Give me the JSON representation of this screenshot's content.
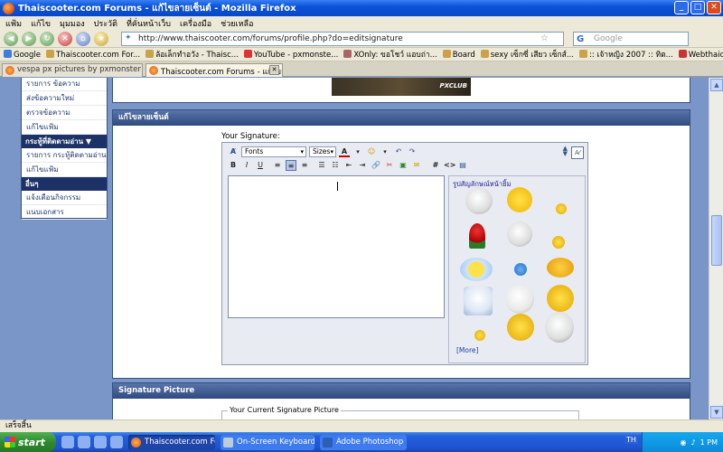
{
  "window": {
    "title": "Thaiscooter.com Forums - แก้ไขลายเซ็นต์ - Mozilla Firefox"
  },
  "menu": [
    "แฟ้ม",
    "แก้ไข",
    "มุมมอง",
    "ประวัติ",
    "ที่คั่นหน้าเว็บ",
    "เครื่องมือ",
    "ช่วยเหลือ"
  ],
  "address": {
    "url": "http://www.thaiscooter.com/forums/profile.php?do=editsignature"
  },
  "search": {
    "placeholder": "Google",
    "engine": "G"
  },
  "bookmarks": [
    "Google",
    "Thaiscooter.com For...",
    "ล้อเล็กทำอวัง - Thaisc...",
    "YouTube - pxmonste...",
    "XOnly: ขอโชว์ แอบถ่า...",
    "Board",
    "sexy เซ็กซี่ เสียว เซ็กส์...",
    ":: เจ้าหญิง 2007 :: ทิต...",
    "Webthaidd.COM รีลอ..."
  ],
  "tabs": [
    {
      "label": "vespa px pictures by pxmonster - ...",
      "active": false
    },
    {
      "label": "Thaiscooter.com Forums - แก้ไขลา...",
      "active": true
    }
  ],
  "sidebar": {
    "items_top": [
      "รายการ ข้อความ",
      "ส่งข้อความใหม่",
      "ตรวจข้อความ",
      "แก้ไขแฟ้ม"
    ],
    "section2": "กระทู้ที่ติดตามอ่าน ▼",
    "items_mid": [
      "รายการ กระทู้ติดตามอ่าน",
      "แก้ไขแฟ้ม"
    ],
    "section3": "อื่นๆ",
    "items_bottom": [
      "แจ้งเตือนกิจกรรม",
      "แนบเอกสาร"
    ]
  },
  "banner": {
    "text": "PXCLUB"
  },
  "panel": {
    "title": "แก้ไขลายเซ็นต์",
    "label": "Your Signature:",
    "fonts_label": "Fonts",
    "sizes_label": "Sizes",
    "smilies_title": "รูปสัญลักษณ์หน้ายิ้ม",
    "more_label": "[More]"
  },
  "panel2": {
    "title": "Signature Picture",
    "legend": "Your Current Signature Picture"
  },
  "status": {
    "text": "เสร็จสิ้น"
  },
  "taskbar": {
    "start": "start",
    "tasks": [
      "Thaiscooter.com Fo...",
      "On-Screen Keyboard",
      "Adobe Photoshop"
    ],
    "lang": "TH",
    "time": "1 PM"
  },
  "colors": {
    "title_bar": "#0a52d8",
    "panel_header": "#2e4a80",
    "sidebar_header": "#1c3165",
    "page_bg": "#7a96c8"
  }
}
